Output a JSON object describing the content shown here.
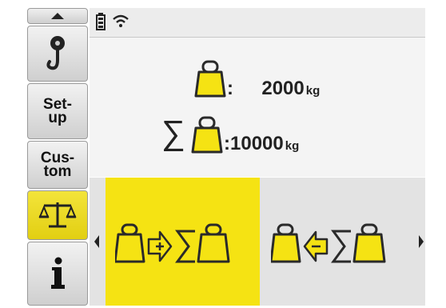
{
  "status": {
    "battery_icon": "battery-icon",
    "wifi_icon": "wifi-icon"
  },
  "sidebar": {
    "items": [
      {
        "name": "scroll-up",
        "icon": "chevron-up-icon"
      },
      {
        "name": "hook",
        "icon": "crane-hook-icon"
      },
      {
        "name": "setup",
        "label": "Set-up"
      },
      {
        "name": "custom",
        "label": "Cus-tom"
      },
      {
        "name": "scale",
        "icon": "scale-icon",
        "active": true
      },
      {
        "name": "info",
        "icon": "info-icon"
      }
    ]
  },
  "display": {
    "current": {
      "sep": ":",
      "value": "2000",
      "unit": "kg"
    },
    "total": {
      "sigma": "∑",
      "sep": ":",
      "value": "10000",
      "unit": "kg"
    }
  },
  "actions": {
    "add_to_total": {
      "icon": "weight-to-sum-icon",
      "highlight": true
    },
    "recall_from_total": {
      "icon": "sum-to-weight-icon",
      "highlight": false
    }
  },
  "colors": {
    "accent": "#f5e313",
    "outline": "#2a2a2a",
    "panel": "#f4f4f4"
  }
}
